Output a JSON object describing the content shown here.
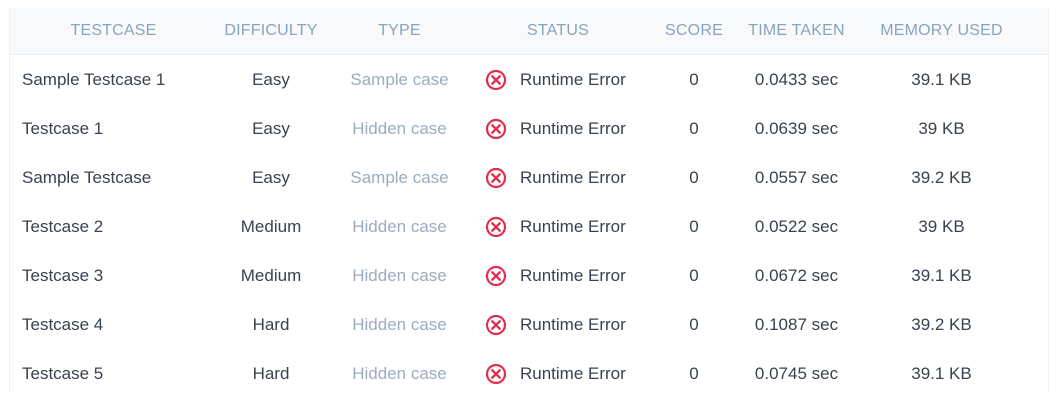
{
  "colors": {
    "header_text": "#8aa3bd",
    "type_text": "#9aacbf",
    "error_red": "#e0304e",
    "body_text": "#39424e",
    "header_bg": "#f8f9fb"
  },
  "headers": {
    "testcase": "TESTCASE",
    "difficulty": "DIFFICULTY",
    "type": "TYPE",
    "status": "STATUS",
    "score": "SCORE",
    "time_taken": "TIME TAKEN",
    "memory_used": "MEMORY USED"
  },
  "rows": [
    {
      "name": "Sample Testcase 1",
      "difficulty": "Easy",
      "type": "Sample case",
      "status_icon": "error-circle-x-icon",
      "status": "Runtime Error",
      "score": "0",
      "time": "0.0433 sec",
      "memory": "39.1 KB"
    },
    {
      "name": "Testcase 1",
      "difficulty": "Easy",
      "type": "Hidden case",
      "status_icon": "error-circle-x-icon",
      "status": "Runtime Error",
      "score": "0",
      "time": "0.0639 sec",
      "memory": "39 KB"
    },
    {
      "name": "Sample Testcase",
      "difficulty": "Easy",
      "type": "Sample case",
      "status_icon": "error-circle-x-icon",
      "status": "Runtime Error",
      "score": "0",
      "time": "0.0557 sec",
      "memory": "39.2 KB"
    },
    {
      "name": "Testcase 2",
      "difficulty": "Medium",
      "type": "Hidden case",
      "status_icon": "error-circle-x-icon",
      "status": "Runtime Error",
      "score": "0",
      "time": "0.0522 sec",
      "memory": "39 KB"
    },
    {
      "name": "Testcase 3",
      "difficulty": "Medium",
      "type": "Hidden case",
      "status_icon": "error-circle-x-icon",
      "status": "Runtime Error",
      "score": "0",
      "time": "0.0672 sec",
      "memory": "39.1 KB"
    },
    {
      "name": "Testcase 4",
      "difficulty": "Hard",
      "type": "Hidden case",
      "status_icon": "error-circle-x-icon",
      "status": "Runtime Error",
      "score": "0",
      "time": "0.1087 sec",
      "memory": "39.2 KB"
    },
    {
      "name": "Testcase 5",
      "difficulty": "Hard",
      "type": "Hidden case",
      "status_icon": "error-circle-x-icon",
      "status": "Runtime Error",
      "score": "0",
      "time": "0.0745 sec",
      "memory": "39.1 KB"
    }
  ]
}
